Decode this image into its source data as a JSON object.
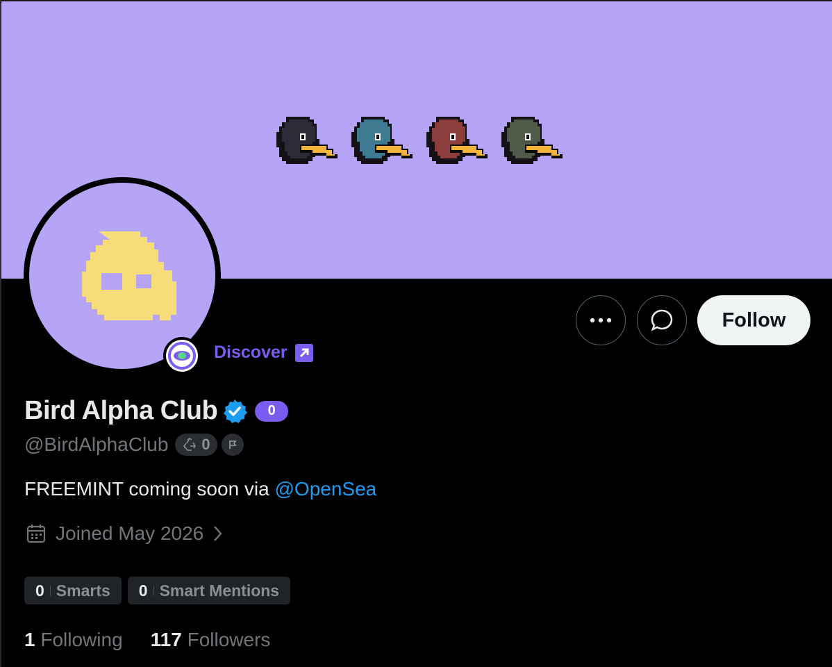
{
  "profile": {
    "display_name": "Bird Alpha Club",
    "score_badge": "0",
    "handle": "@BirdAlphaClub",
    "recycle_count": "0",
    "bio_text": "FREEMINT coming soon via ",
    "bio_mention": "@OpenSea",
    "joined": "Joined May 2026",
    "discover_label": "Discover"
  },
  "actions": {
    "follow_label": "Follow"
  },
  "stats": {
    "smarts_count": "0",
    "smarts_label": "Smarts",
    "smart_mentions_count": "0",
    "smart_mentions_label": "Smart Mentions",
    "following_count": "1",
    "following_label": "Following",
    "followers_count": "117",
    "followers_label": "Followers"
  },
  "colors": {
    "banner": "#b6a5f6",
    "accent_purple": "#7b5cf0",
    "link_blue": "#1d9bf0",
    "avatar_yellow": "#f6dd7a"
  },
  "icons": [
    "more-icon",
    "message-icon",
    "verified-icon",
    "recycle-icon",
    "flag-icon",
    "calendar-icon",
    "chevron-right-icon",
    "external-link-icon",
    "eye-icon"
  ]
}
